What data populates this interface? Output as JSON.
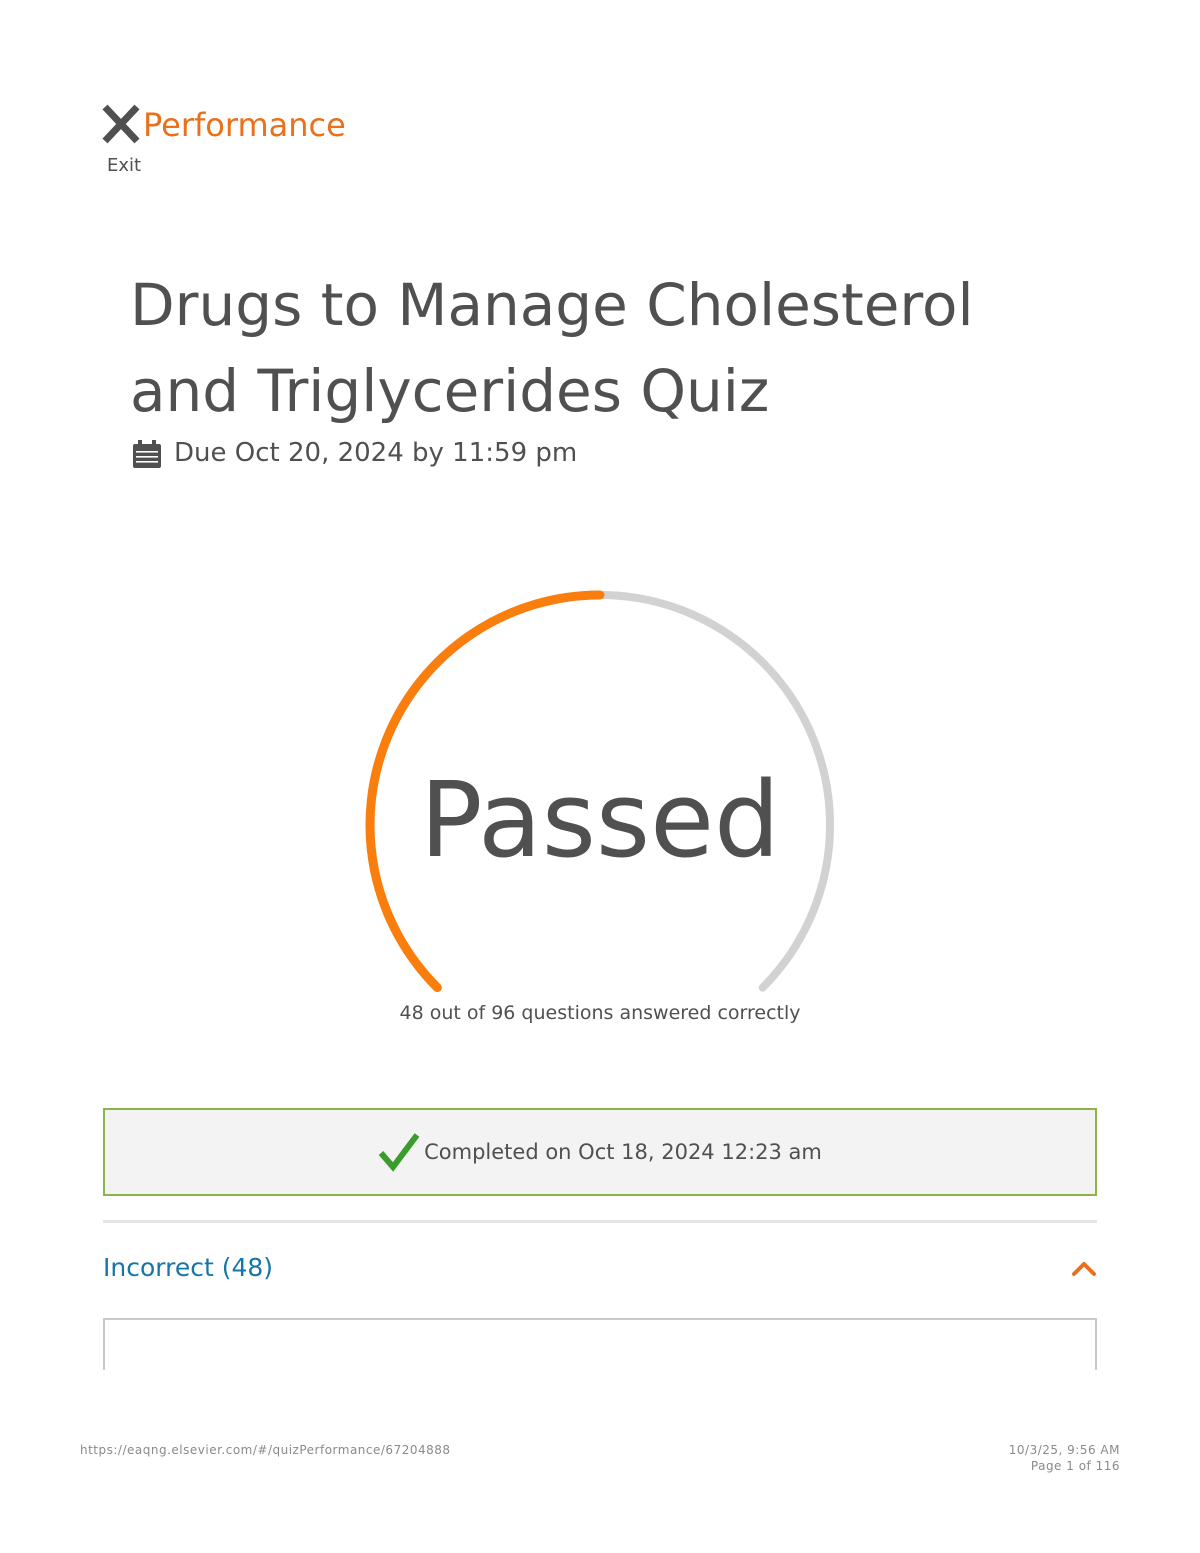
{
  "header": {
    "app_title": "Performance",
    "exit_label": "Exit"
  },
  "quiz": {
    "title": "Drugs to Manage Cholesterol and Triglycerides Quiz",
    "due_date": "Due Oct 20, 2024 by 11:59 pm"
  },
  "result": {
    "status": "Passed",
    "correct": 48,
    "total": 96,
    "caption": "48 out of 96 questions answered correctly",
    "completed_text": "Completed on Oct 18, 2024 12:23 am"
  },
  "sections": {
    "incorrect_label": "Incorrect (48)"
  },
  "footer": {
    "url": "https://eaqng.elsevier.com/#/quizPerformance/67204888",
    "timestamp": "10/3/25, 9:56 AM",
    "page": "Page 1 of 116"
  },
  "colors": {
    "accent_orange": "#e9711c",
    "gauge_progress": "#fa7e0d",
    "gauge_track": "#d2d2d2",
    "success_green": "#3a9c2c",
    "success_border": "#8cb34a",
    "link_blue": "#1676a9"
  },
  "icons": {
    "close": "close-icon",
    "calendar": "calendar-icon",
    "check": "check-icon",
    "chevron": "chevron-up-icon"
  }
}
